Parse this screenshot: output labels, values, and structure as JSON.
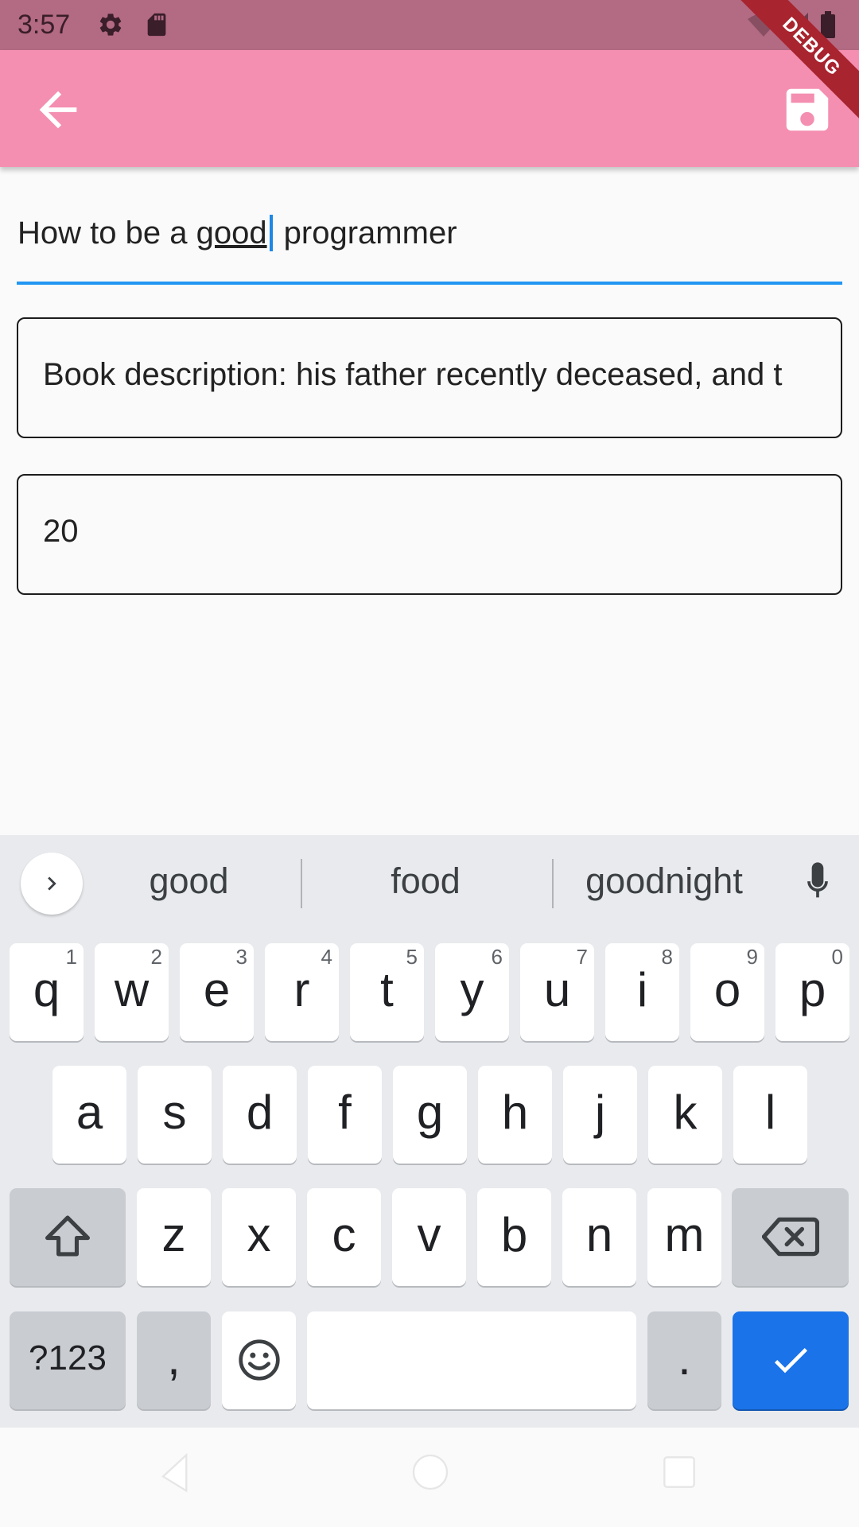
{
  "status_bar": {
    "time": "3:57",
    "icons": [
      "settings-gear-icon",
      "sd-card-icon",
      "wifi-icon",
      "signal-icon",
      "battery-icon"
    ]
  },
  "debug_banner": "DEBUG",
  "app_bar": {
    "background": "#f48fb1",
    "back_icon": "arrow-back-icon",
    "save_icon": "save-floppy-icon"
  },
  "form": {
    "title": {
      "before": "How to be a ",
      "composing": "good",
      "after": " programmer"
    },
    "description": "Book description:  his father recently deceased, and t",
    "price": "20"
  },
  "keyboard": {
    "suggestions": [
      "good",
      "food",
      "goodnight"
    ],
    "row1": [
      {
        "k": "q",
        "h": "1"
      },
      {
        "k": "w",
        "h": "2"
      },
      {
        "k": "e",
        "h": "3"
      },
      {
        "k": "r",
        "h": "4"
      },
      {
        "k": "t",
        "h": "5"
      },
      {
        "k": "y",
        "h": "6"
      },
      {
        "k": "u",
        "h": "7"
      },
      {
        "k": "i",
        "h": "8"
      },
      {
        "k": "o",
        "h": "9"
      },
      {
        "k": "p",
        "h": "0"
      }
    ],
    "row2": [
      "a",
      "s",
      "d",
      "f",
      "g",
      "h",
      "j",
      "k",
      "l"
    ],
    "row3": [
      "z",
      "x",
      "c",
      "v",
      "b",
      "n",
      "m"
    ],
    "symbols_label": "?123",
    "comma": ",",
    "period": ".",
    "accent": "#1a73e8"
  },
  "nav_bar": {
    "icons": [
      "back-triangle-icon",
      "home-circle-icon",
      "recents-square-icon"
    ]
  }
}
